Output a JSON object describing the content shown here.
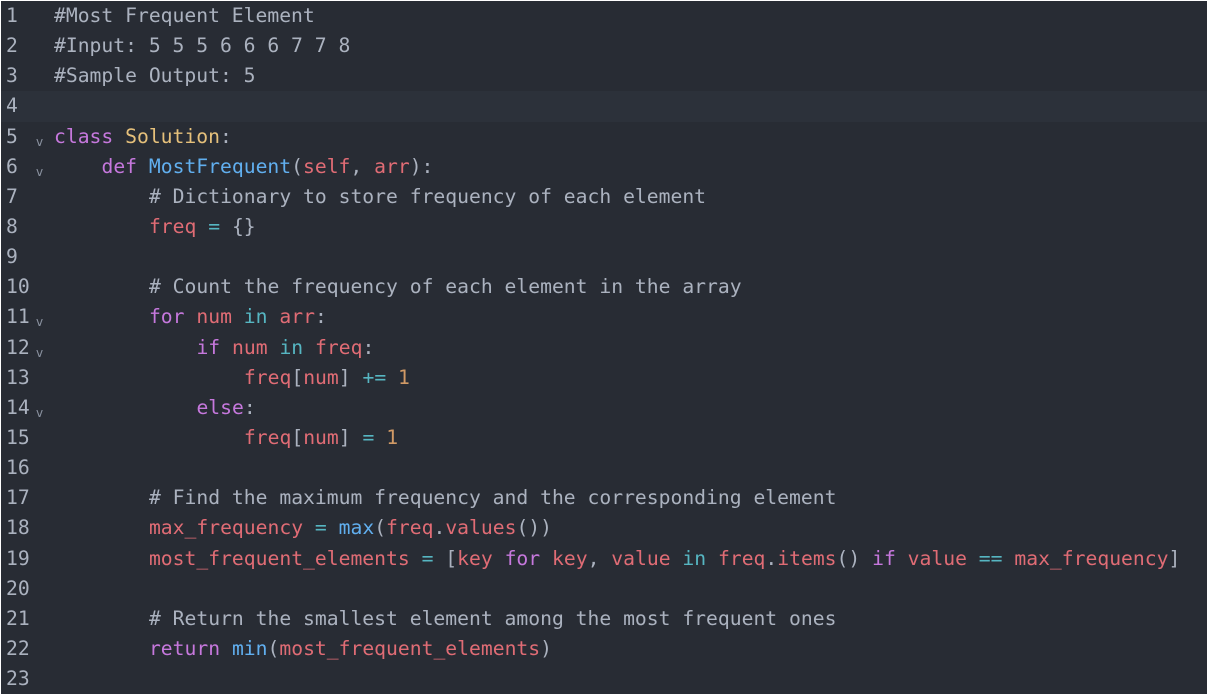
{
  "editor": {
    "language": "python",
    "theme": "dark",
    "active_line": 4,
    "colors": {
      "background": "#282c34",
      "active_line": "#2c313a",
      "comment": "#abb2bf",
      "keyword": "#c678dd",
      "class": "#e5c07b",
      "function": "#61afef",
      "variable": "#e06c75",
      "operator": "#56b6c2",
      "number": "#d19a66",
      "text": "#abb2bf"
    },
    "fold_icon": "chevron-down-icon",
    "lines": [
      {
        "number": "1",
        "fold": false,
        "indent": 0,
        "tokens": [
          {
            "t": "comment",
            "v": "#Most Frequent Element"
          }
        ]
      },
      {
        "number": "2",
        "fold": false,
        "indent": 0,
        "tokens": [
          {
            "t": "comment",
            "v": "#Input: 5 5 5 6 6 6 7 7 8"
          }
        ]
      },
      {
        "number": "3",
        "fold": false,
        "indent": 0,
        "tokens": [
          {
            "t": "comment",
            "v": "#Sample Output: 5"
          }
        ]
      },
      {
        "number": "4",
        "fold": false,
        "indent": 0,
        "tokens": []
      },
      {
        "number": "5",
        "fold": true,
        "indent": 0,
        "tokens": [
          {
            "t": "keyword",
            "v": "class"
          },
          {
            "t": "punc",
            "v": " "
          },
          {
            "t": "class",
            "v": "Solution"
          },
          {
            "t": "punc",
            "v": ":"
          }
        ]
      },
      {
        "number": "6",
        "fold": true,
        "indent": 4,
        "tokens": [
          {
            "t": "keyword",
            "v": "def"
          },
          {
            "t": "punc",
            "v": " "
          },
          {
            "t": "func",
            "v": "MostFrequent"
          },
          {
            "t": "punc",
            "v": "("
          },
          {
            "t": "var",
            "v": "self"
          },
          {
            "t": "punc",
            "v": ", "
          },
          {
            "t": "var",
            "v": "arr"
          },
          {
            "t": "punc",
            "v": "):"
          }
        ]
      },
      {
        "number": "7",
        "fold": false,
        "indent": 8,
        "tokens": [
          {
            "t": "comment",
            "v": "# Dictionary to store frequency of each element"
          }
        ]
      },
      {
        "number": "8",
        "fold": false,
        "indent": 8,
        "tokens": [
          {
            "t": "var",
            "v": "freq"
          },
          {
            "t": "punc",
            "v": " "
          },
          {
            "t": "op",
            "v": "="
          },
          {
            "t": "punc",
            "v": " {}"
          }
        ]
      },
      {
        "number": "9",
        "fold": false,
        "indent": 0,
        "tokens": []
      },
      {
        "number": "10",
        "fold": false,
        "indent": 8,
        "tokens": [
          {
            "t": "comment",
            "v": "# Count the frequency of each element in the array"
          }
        ]
      },
      {
        "number": "11",
        "fold": true,
        "indent": 8,
        "tokens": [
          {
            "t": "keyword",
            "v": "for"
          },
          {
            "t": "punc",
            "v": " "
          },
          {
            "t": "var",
            "v": "num"
          },
          {
            "t": "punc",
            "v": " "
          },
          {
            "t": "op",
            "v": "in"
          },
          {
            "t": "punc",
            "v": " "
          },
          {
            "t": "var",
            "v": "arr"
          },
          {
            "t": "punc",
            "v": ":"
          }
        ]
      },
      {
        "number": "12",
        "fold": true,
        "indent": 12,
        "tokens": [
          {
            "t": "keyword",
            "v": "if"
          },
          {
            "t": "punc",
            "v": " "
          },
          {
            "t": "var",
            "v": "num"
          },
          {
            "t": "punc",
            "v": " "
          },
          {
            "t": "op",
            "v": "in"
          },
          {
            "t": "punc",
            "v": " "
          },
          {
            "t": "var",
            "v": "freq"
          },
          {
            "t": "punc",
            "v": ":"
          }
        ]
      },
      {
        "number": "13",
        "fold": false,
        "indent": 16,
        "tokens": [
          {
            "t": "var",
            "v": "freq"
          },
          {
            "t": "punc",
            "v": "["
          },
          {
            "t": "var",
            "v": "num"
          },
          {
            "t": "punc",
            "v": "] "
          },
          {
            "t": "op",
            "v": "+="
          },
          {
            "t": "punc",
            "v": " "
          },
          {
            "t": "num",
            "v": "1"
          }
        ]
      },
      {
        "number": "14",
        "fold": true,
        "indent": 12,
        "tokens": [
          {
            "t": "keyword",
            "v": "else"
          },
          {
            "t": "punc",
            "v": ":"
          }
        ]
      },
      {
        "number": "15",
        "fold": false,
        "indent": 16,
        "tokens": [
          {
            "t": "var",
            "v": "freq"
          },
          {
            "t": "punc",
            "v": "["
          },
          {
            "t": "var",
            "v": "num"
          },
          {
            "t": "punc",
            "v": "] "
          },
          {
            "t": "op",
            "v": "="
          },
          {
            "t": "punc",
            "v": " "
          },
          {
            "t": "num",
            "v": "1"
          }
        ]
      },
      {
        "number": "16",
        "fold": false,
        "indent": 0,
        "tokens": []
      },
      {
        "number": "17",
        "fold": false,
        "indent": 8,
        "tokens": [
          {
            "t": "comment",
            "v": "# Find the maximum frequency and the corresponding element"
          }
        ]
      },
      {
        "number": "18",
        "fold": false,
        "indent": 8,
        "tokens": [
          {
            "t": "var",
            "v": "max_frequency"
          },
          {
            "t": "punc",
            "v": " "
          },
          {
            "t": "op",
            "v": "="
          },
          {
            "t": "punc",
            "v": " "
          },
          {
            "t": "func",
            "v": "max"
          },
          {
            "t": "punc",
            "v": "("
          },
          {
            "t": "var",
            "v": "freq"
          },
          {
            "t": "punc",
            "v": "."
          },
          {
            "t": "var",
            "v": "values"
          },
          {
            "t": "punc",
            "v": "())"
          }
        ]
      },
      {
        "number": "19",
        "fold": false,
        "indent": 8,
        "tokens": [
          {
            "t": "var",
            "v": "most_frequent_elements"
          },
          {
            "t": "punc",
            "v": " "
          },
          {
            "t": "op",
            "v": "="
          },
          {
            "t": "punc",
            "v": " ["
          },
          {
            "t": "var",
            "v": "key"
          },
          {
            "t": "punc",
            "v": " "
          },
          {
            "t": "keyword",
            "v": "for"
          },
          {
            "t": "punc",
            "v": " "
          },
          {
            "t": "var",
            "v": "key"
          },
          {
            "t": "punc",
            "v": ", "
          },
          {
            "t": "var",
            "v": "value"
          },
          {
            "t": "punc",
            "v": " "
          },
          {
            "t": "op",
            "v": "in"
          },
          {
            "t": "punc",
            "v": " "
          },
          {
            "t": "var",
            "v": "freq"
          },
          {
            "t": "punc",
            "v": "."
          },
          {
            "t": "var",
            "v": "items"
          },
          {
            "t": "punc",
            "v": "() "
          },
          {
            "t": "keyword",
            "v": "if"
          },
          {
            "t": "punc",
            "v": " "
          },
          {
            "t": "var",
            "v": "value"
          },
          {
            "t": "punc",
            "v": " "
          },
          {
            "t": "op",
            "v": "=="
          },
          {
            "t": "punc",
            "v": " "
          },
          {
            "t": "var",
            "v": "max_frequency"
          },
          {
            "t": "punc",
            "v": "]"
          }
        ]
      },
      {
        "number": "20",
        "fold": false,
        "indent": 0,
        "tokens": []
      },
      {
        "number": "21",
        "fold": false,
        "indent": 8,
        "tokens": [
          {
            "t": "comment",
            "v": "# Return the smallest element among the most frequent ones"
          }
        ]
      },
      {
        "number": "22",
        "fold": false,
        "indent": 8,
        "tokens": [
          {
            "t": "keyword",
            "v": "return"
          },
          {
            "t": "punc",
            "v": " "
          },
          {
            "t": "func",
            "v": "min"
          },
          {
            "t": "punc",
            "v": "("
          },
          {
            "t": "var",
            "v": "most_frequent_elements"
          },
          {
            "t": "punc",
            "v": ")"
          }
        ]
      },
      {
        "number": "23",
        "fold": false,
        "indent": 0,
        "tokens": []
      }
    ]
  }
}
